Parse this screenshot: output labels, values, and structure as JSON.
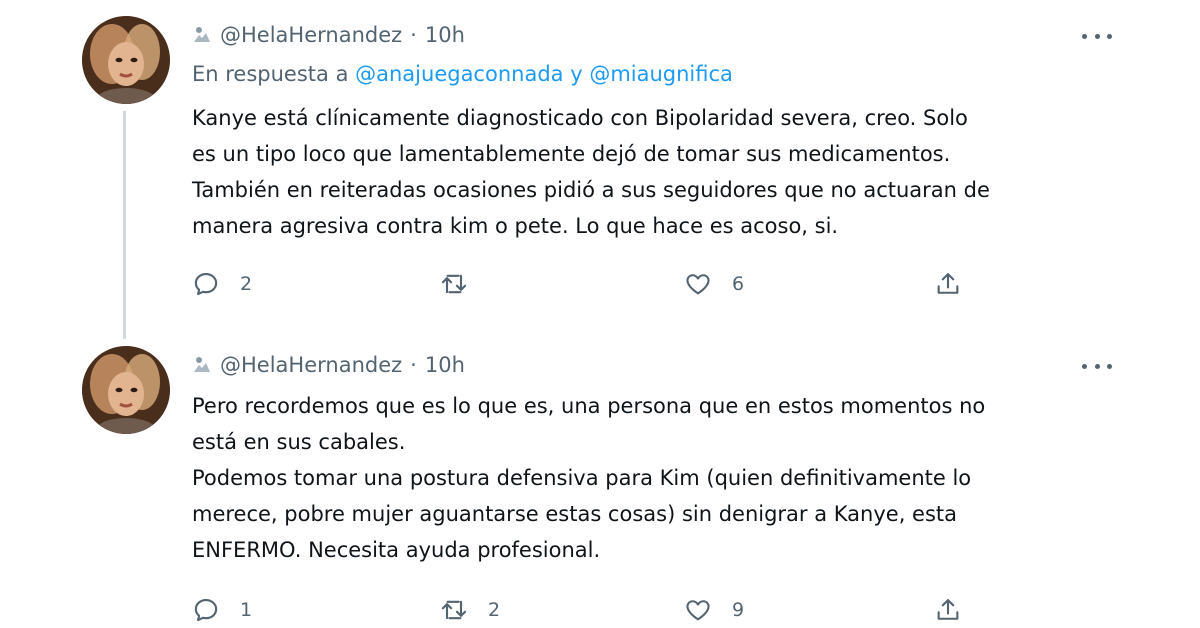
{
  "tweets": [
    {
      "handle": "@HelaHernandez",
      "time": "10h",
      "reply_prefix": "En respuesta a",
      "reply_user_1": "@anajuegaconnada",
      "reply_joiner": "y",
      "reply_user_2": "@miaugnifica",
      "lines": [
        "Kanye está clínicamente diagnosticado con Bipolaridad severa, creo. Solo",
        "es un tipo loco que lamentablemente dejó de tomar sus medicamentos.",
        "También en reiteradas ocasiones pidió a sus seguidores que no actuaran de",
        "manera agresiva contra kim o pete. Lo que hace es acoso, si."
      ],
      "replies": "2",
      "retweets": "",
      "likes": "6"
    },
    {
      "handle": "@HelaHernandez",
      "time": "10h",
      "lines": [
        "Pero recordemos que es lo que es, una persona que en estos momentos no",
        "está en sus cabales.",
        "Podemos tomar una postura defensiva para Kim (quien definitivamente lo",
        "merece, pobre mujer aguantarse estas cosas) sin denigrar a Kanye, esta",
        "ENFERMO. Necesita ayuda profesional."
      ],
      "replies": "1",
      "retweets": "2",
      "likes": "9"
    }
  ],
  "colors": {
    "accent": "#1d9bf0",
    "secondary_text": "#536471",
    "primary_text": "#0f1419",
    "thread_line": "#cfd9de"
  },
  "icons": {
    "reply": "speech-bubble-icon",
    "retweet": "retweet-arrows-icon",
    "like": "heart-icon",
    "share": "share-upload-icon",
    "more": "ellipsis-icon"
  }
}
